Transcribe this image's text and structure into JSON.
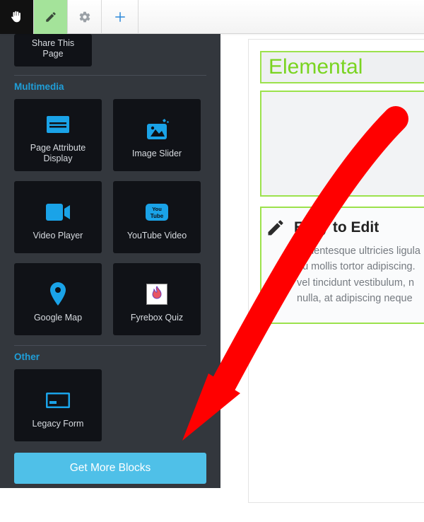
{
  "topbar": {
    "logo_name": "concrete5-logo",
    "edit_name": "edit-pencil",
    "settings_name": "settings-gear",
    "add_name": "add-plus"
  },
  "share_tile": {
    "line1": "Share This",
    "line2": "Page"
  },
  "sections": {
    "multimedia": {
      "title": "Multimedia",
      "tiles": [
        {
          "key": "page-attr",
          "label": "Page Attribute Display"
        },
        {
          "key": "image-slider",
          "label": "Image Slider"
        },
        {
          "key": "video-player",
          "label": "Video Player"
        },
        {
          "key": "youtube",
          "label": "YouTube Video"
        },
        {
          "key": "google-map",
          "label": "Google Map"
        },
        {
          "key": "fyrebox",
          "label": "Fyrebox Quiz"
        }
      ]
    },
    "other": {
      "title": "Other",
      "tiles": [
        {
          "key": "legacy-form",
          "label": "Legacy Form"
        }
      ]
    }
  },
  "get_more_label": "Get More Blocks",
  "page": {
    "site_title": "Elemental",
    "article": {
      "title": "Easy to Edit",
      "body": "Pellentesque ultricies ligula\neu mollis tortor adipiscing.\nvel tincidunt vestibulum, n\nnulla, at adipiscing neque "
    }
  }
}
